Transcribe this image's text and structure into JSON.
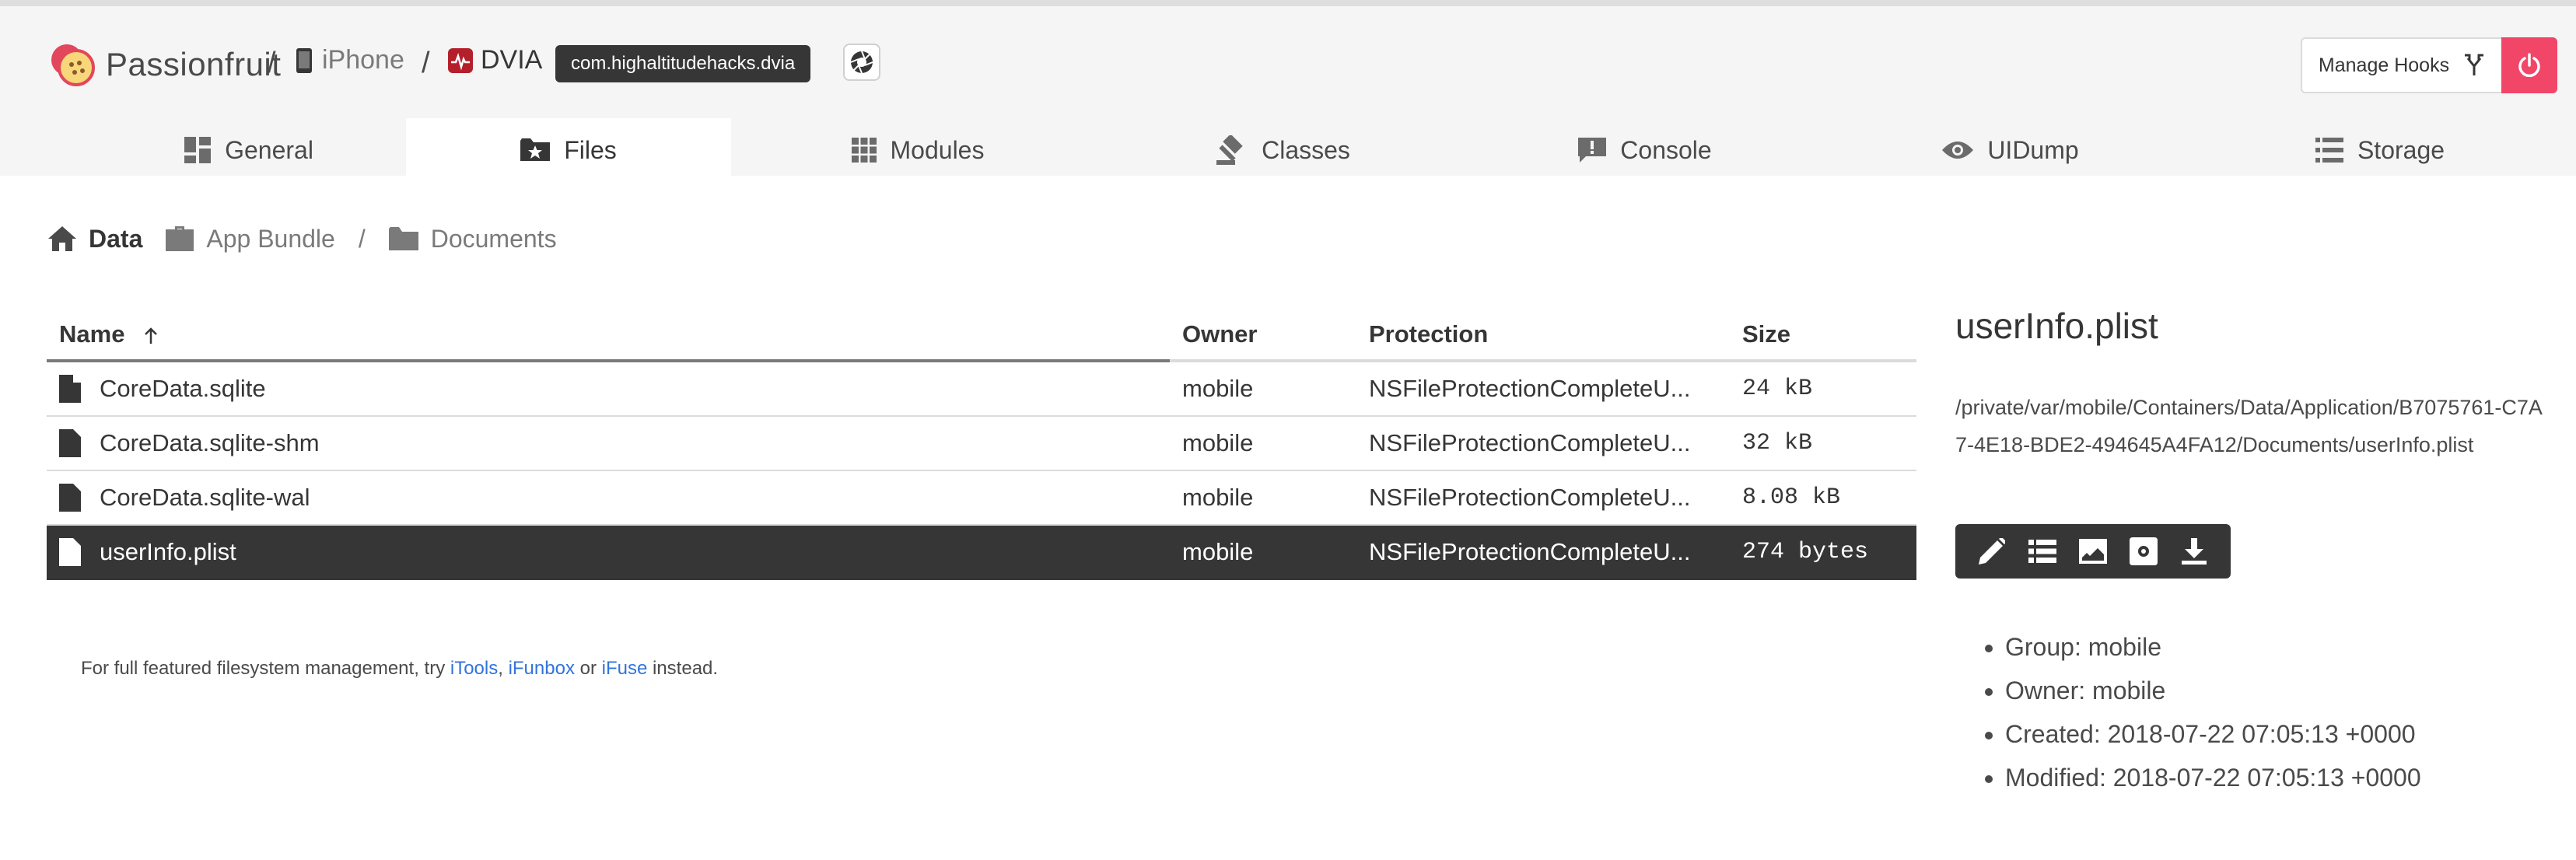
{
  "header": {
    "brand": "Passionfruit",
    "separator": "/",
    "device": "iPhone",
    "app_name": "DVIA",
    "bundle_id": "com.highaltitudehacks.dvia",
    "manage_hooks_label": "Manage Hooks",
    "accent_color": "#f14668"
  },
  "tabs": [
    {
      "label": "General",
      "icon": "dashboard-icon"
    },
    {
      "label": "Files",
      "icon": "folder-star-icon"
    },
    {
      "label": "Modules",
      "icon": "grid-icon"
    },
    {
      "label": "Classes",
      "icon": "gavel-icon"
    },
    {
      "label": "Console",
      "icon": "comment-alert-icon"
    },
    {
      "label": "UIDump",
      "icon": "eye-icon"
    },
    {
      "label": "Storage",
      "icon": "list-icon"
    }
  ],
  "active_tab": "Files",
  "path": {
    "home_label": "Data",
    "bundle_label": "App Bundle",
    "separator": "/",
    "folder_label": "Documents"
  },
  "table": {
    "columns": [
      "Name",
      "Owner",
      "Protection",
      "Size"
    ],
    "rows": [
      {
        "name": "CoreData.sqlite",
        "owner": "mobile",
        "protection": "NSFileProtectionCompleteU...",
        "size": "24 kB"
      },
      {
        "name": "CoreData.sqlite-shm",
        "owner": "mobile",
        "protection": "NSFileProtectionCompleteU...",
        "size": "32 kB"
      },
      {
        "name": "CoreData.sqlite-wal",
        "owner": "mobile",
        "protection": "NSFileProtectionCompleteU...",
        "size": "8.08 kB"
      },
      {
        "name": "userInfo.plist",
        "owner": "mobile",
        "protection": "NSFileProtectionCompleteU...",
        "size": "274 bytes",
        "selected": true
      }
    ]
  },
  "footnote": {
    "prefix": "For full featured filesystem management, try ",
    "link1": "iTools",
    "comma": ", ",
    "link2": "iFunbox",
    "or": " or ",
    "link3": "iFuse",
    "suffix": " instead."
  },
  "detail": {
    "title": "userInfo.plist",
    "path": "/private/var/mobile/Containers/Data/Application/B7075761-C7A7-4E18-BDE2-494645A4FA12/Documents/userInfo.plist",
    "actions": [
      "edit-icon",
      "list-icon",
      "image-icon",
      "settings-icon",
      "download-icon"
    ],
    "meta": [
      "Group: mobile",
      "Owner: mobile",
      "Created: 2018-07-22 07:05:13 +0000",
      "Modified: 2018-07-22 07:05:13 +0000"
    ]
  }
}
